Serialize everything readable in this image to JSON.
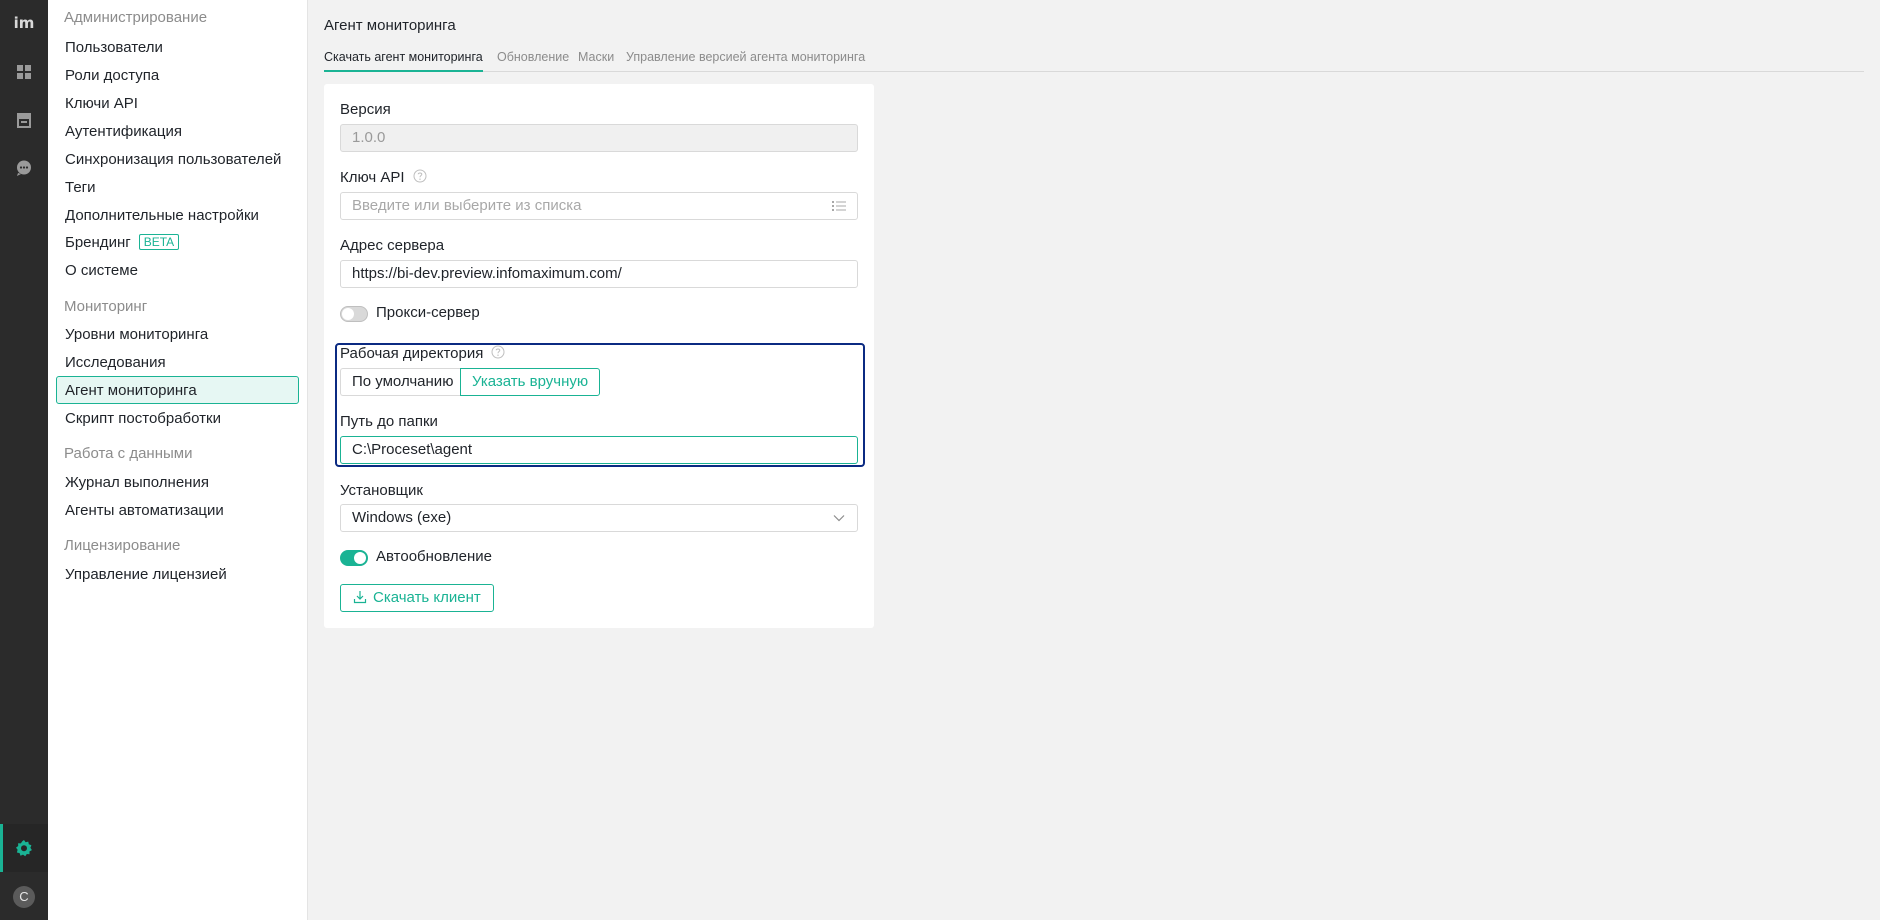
{
  "rail": {
    "logo": "im",
    "avatar_letter": "C",
    "icons": [
      "dashboard-icon",
      "store-icon",
      "chat-icon",
      "settings-icon"
    ],
    "accent": "#1ab394"
  },
  "sidebar": {
    "sections": [
      {
        "title": "Администрирование",
        "items": [
          {
            "label": "Пользователи"
          },
          {
            "label": "Роли доступа"
          },
          {
            "label": "Ключи API"
          },
          {
            "label": "Аутентификация"
          },
          {
            "label": "Синхронизация пользователей"
          },
          {
            "label": "Теги"
          },
          {
            "label": "Дополнительные настройки"
          },
          {
            "label": "Брендинг",
            "badge": "BETA"
          },
          {
            "label": "О системе"
          }
        ]
      },
      {
        "title": "Мониторинг",
        "items": [
          {
            "label": "Уровни мониторинга"
          },
          {
            "label": "Исследования"
          },
          {
            "label": "Агент мониторинга",
            "active": true
          },
          {
            "label": "Скрипт постобработки"
          }
        ]
      },
      {
        "title": "Работа с данными",
        "items": [
          {
            "label": "Журнал выполнения"
          },
          {
            "label": "Агенты автоматизации"
          }
        ]
      },
      {
        "title": "Лицензирование",
        "items": [
          {
            "label": "Управление лицензией"
          }
        ]
      }
    ]
  },
  "main": {
    "title": "Агент мониторинга",
    "tabs": [
      {
        "label": "Скачать агент мониторинга",
        "active": true
      },
      {
        "label": "Обновление"
      },
      {
        "label": "Маски"
      },
      {
        "label": "Управление версией агента мониторинга"
      }
    ],
    "form": {
      "version": {
        "label": "Версия",
        "value": "1.0.0"
      },
      "api_key": {
        "label": "Ключ API",
        "placeholder": "Введите или выберите из списка"
      },
      "server": {
        "label": "Адрес сервера",
        "value": "https://bi-dev.preview.infomaximum.com/"
      },
      "proxy": {
        "label": "Прокси-сервер",
        "enabled": false
      },
      "workdir": {
        "label": "Рабочая директория",
        "options": [
          "По умолчанию",
          "Указать вручную"
        ],
        "selected": "Указать вручную"
      },
      "folder_path": {
        "label": "Путь до папки",
        "value": "C:\\Proceset\\agent"
      },
      "installer": {
        "label": "Установщик",
        "value": "Windows (exe)"
      },
      "autoupdate": {
        "label": "Автообновление",
        "enabled": true
      },
      "download_button": "Скачать клиент"
    }
  }
}
